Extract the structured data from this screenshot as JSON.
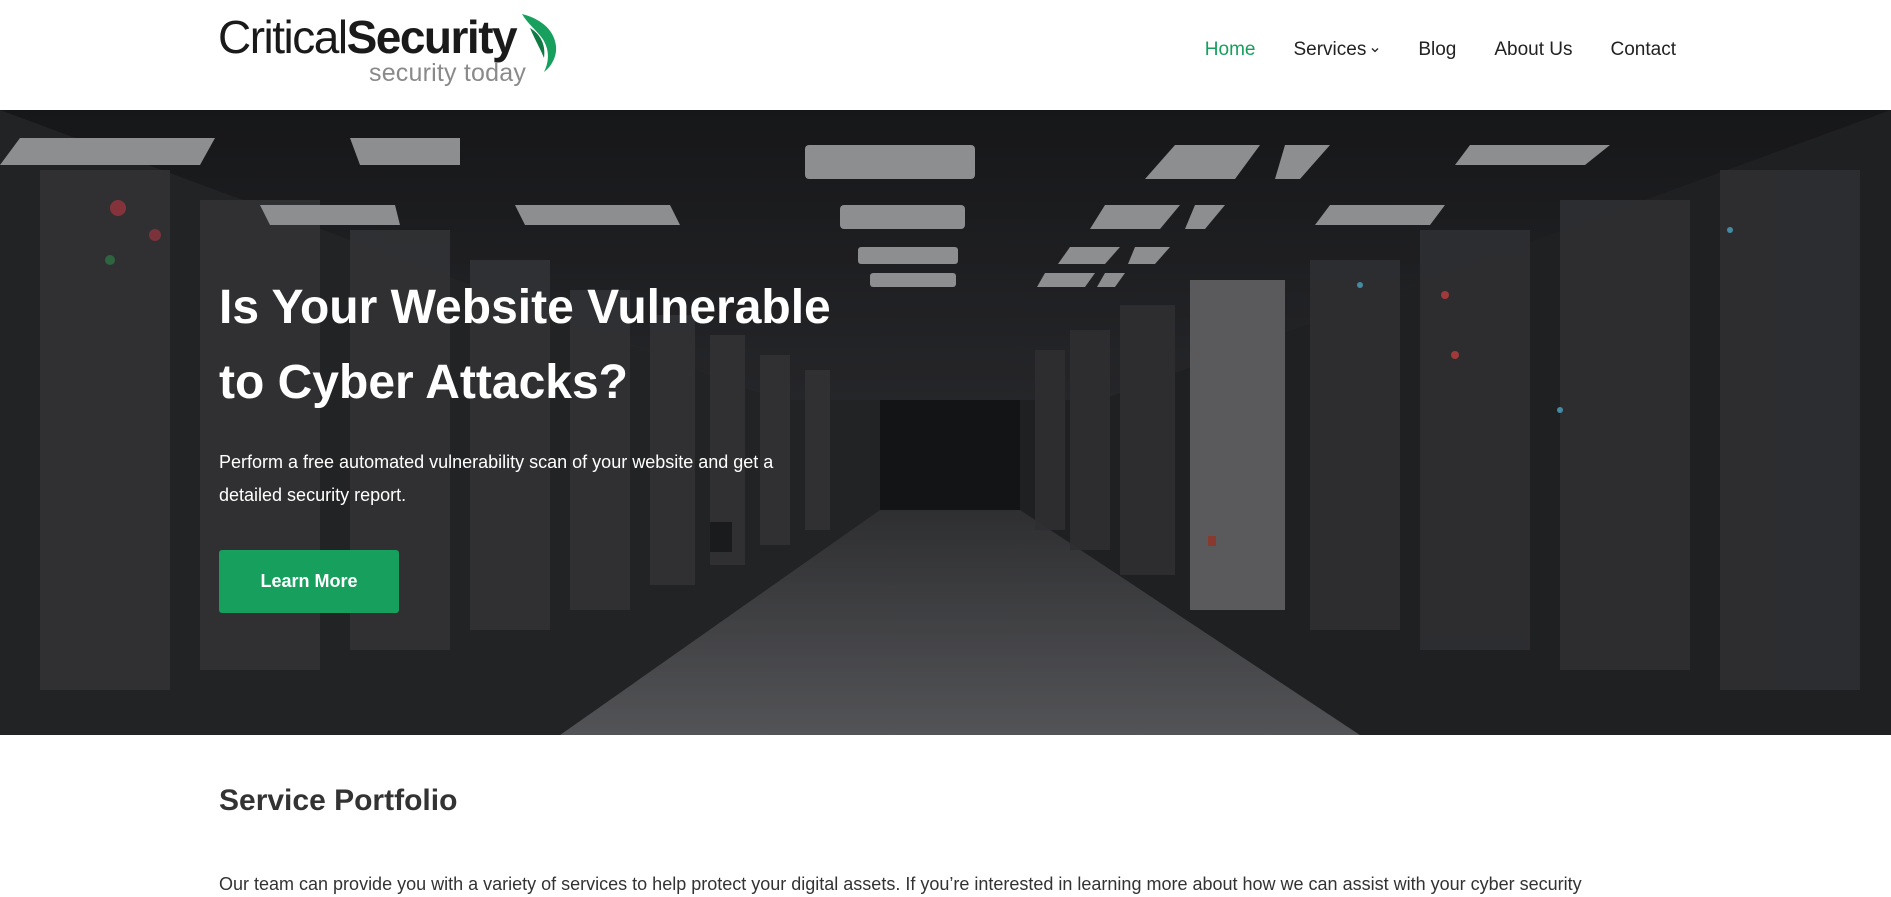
{
  "header": {
    "logo": {
      "word_light": "Critical",
      "word_bold": "Security",
      "tagline": "security today"
    },
    "nav": [
      {
        "label": "Home",
        "active": true
      },
      {
        "label": "Services",
        "has_dropdown": true
      },
      {
        "label": "Blog"
      },
      {
        "label": "About Us"
      },
      {
        "label": "Contact"
      }
    ],
    "dropdown_icon": "chevron-down-icon"
  },
  "hero": {
    "title": "Is Your Website Vulnerable to Cyber Attacks?",
    "text": "Perform a free automated vulnerability scan of your website and get a detailed security report.",
    "button_label": "Learn More",
    "background": "server-room-photo"
  },
  "portfolio": {
    "title": "Service Portfolio",
    "text": "Our team can provide you with a variety of services to help protect your digital assets. If you’re interested in learning more about how we can assist with your cyber security"
  },
  "colors": {
    "accent": "#17a05d",
    "text": "#333333",
    "white": "#ffffff"
  }
}
